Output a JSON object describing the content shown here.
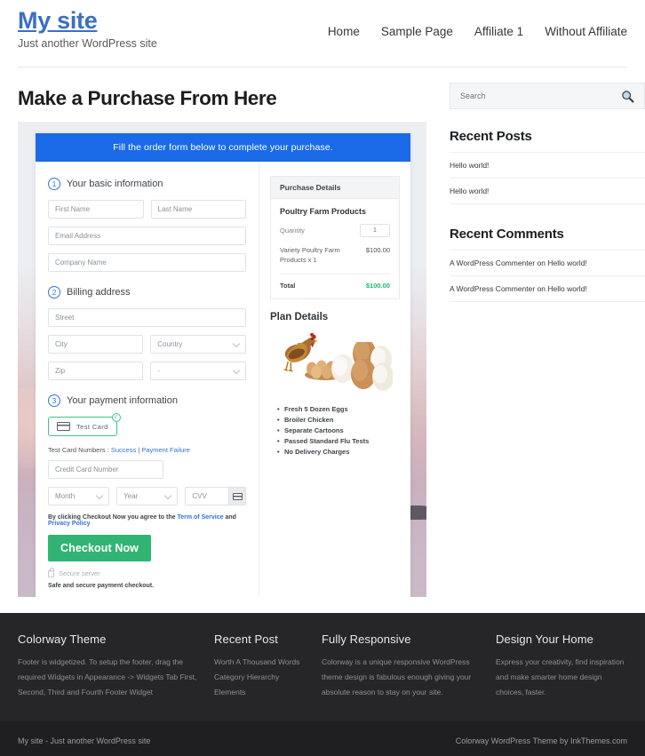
{
  "header": {
    "site_title": "My site",
    "tagline": "Just another WordPress site",
    "nav": [
      {
        "label": "Home"
      },
      {
        "label": "Sample Page"
      },
      {
        "label": "Affiliate 1"
      },
      {
        "label": "Without Affiliate"
      }
    ]
  },
  "main": {
    "page_title": "Make a Purchase From Here",
    "banner": "Fill the order form below to complete your purchase.",
    "steps": {
      "step1": {
        "num": "1",
        "label": "Your basic information"
      },
      "step2": {
        "num": "2",
        "label": "Billing address"
      },
      "step3": {
        "num": "3",
        "label": "Your payment information"
      }
    },
    "fields": {
      "first_name": "First Name",
      "last_name": "Last Name",
      "email": "Email Address",
      "company": "Company Name",
      "street": "Street",
      "city": "City",
      "country": "Country",
      "zip": "Zip",
      "state": "-",
      "credit_card": "Credit Card Number",
      "month": "Month",
      "year": "Year",
      "cvv": "CVV"
    },
    "payment": {
      "card_chip_label": "Test Card",
      "chip_badge": "✓",
      "test_card_prefix": "Test Card Numbers : ",
      "test_card_success": "Success",
      "test_card_sep": " | ",
      "test_card_failure": "Payment Failure",
      "terms_prefix": "By clicking Checkout Now you agree to the ",
      "terms_tos": "Term of Service",
      "terms_and": " and ",
      "terms_privacy": "Privacy Policy",
      "checkout_button": "Checkout Now",
      "secure_server": "Secure server",
      "safe_text": "Safe and secure payment checkout."
    },
    "summary": {
      "box_title": "Purchase Details",
      "product_name": "Poultry Farm Products",
      "quantity_label": "Quantity",
      "quantity_value": "1",
      "line_desc": "Variety Poultry Farm Products x 1",
      "line_amount": "$100.00",
      "total_label": "Total",
      "total_amount": "$100.00",
      "plan_title": "Plan Details",
      "plan_features": [
        "Fresh 5 Dozen Eggs",
        "Broiler Chicken",
        "Separate Cartoons",
        "Passed Standard Flu Tests",
        "No Delivery Charges"
      ]
    }
  },
  "sidebar": {
    "search_placeholder": "Search",
    "recent_posts_title": "Recent Posts",
    "recent_posts": [
      {
        "label": "Hello world!"
      },
      {
        "label": "Hello world!"
      }
    ],
    "recent_comments_title": "Recent Comments",
    "recent_comments": [
      {
        "label": "A WordPress Commenter on Hello world!"
      },
      {
        "label": "A WordPress Commenter on Hello world!"
      }
    ]
  },
  "footer": {
    "columns": [
      {
        "title": "Colorway Theme",
        "text": "Footer is widgetized. To setup the footer, drag the required Widgets in Appearance -> Widgets Tab First, Second, Third and Fourth Footer Widget"
      },
      {
        "title": "Recent Post",
        "links": [
          {
            "label": "Worth A Thousand Words"
          },
          {
            "label": "Category Hierarchy"
          },
          {
            "label": "Elements"
          }
        ]
      },
      {
        "title": "Fully Responsive",
        "text": "Colorway is a unique responsive WordPress theme design is fabulous enough giving your absolute reason to stay on your site."
      },
      {
        "title": "Design Your Home",
        "text": "Express your creativity, find inspiration and make smarter home design choices, faster."
      }
    ],
    "bottom_left": "My site - Just another WordPress site",
    "bottom_right": "Colorway WordPress Theme by InkThemes.com"
  },
  "colors": {
    "brand_blue": "#3b6fc4",
    "banner_blue": "#1a6ae8",
    "accent_green": "#31b473",
    "total_green": "#1fb773",
    "footer_dark": "#262628",
    "bottom_dark": "#1f1f21"
  }
}
